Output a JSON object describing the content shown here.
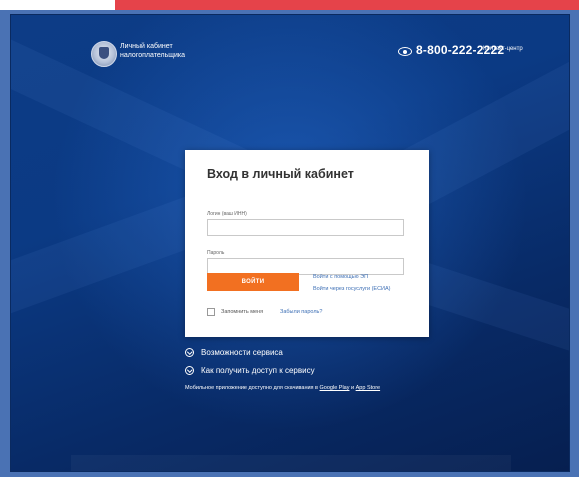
{
  "header": {
    "brand_line1": "Личный кабинет",
    "brand_line2": "налогоплательщика",
    "phone": "8-800-222-2222",
    "contact_center": "Контакт-центр"
  },
  "login": {
    "title": "Вход в личный кабинет",
    "login_label": "Логин (ваш ИНН)",
    "login_value": "",
    "password_label": "Пароль",
    "password_value": "",
    "submit_label": "ВОЙТИ",
    "ep_link": "Войти с помощью ЭП",
    "esia_link": "Войти через госуслуги (ЕСИА)",
    "remember_label": "Запомнить меня",
    "forgot_link": "Забыли пароль?"
  },
  "sections": {
    "features": "Возможности сервиса",
    "how_to_access": "Как получить доступ к сервису"
  },
  "mobile": {
    "text": "Мобильное приложение доступно для скачивания в ",
    "google_play": "Google Play",
    "and": " и ",
    "app_store": "App Store"
  },
  "icons": {
    "eye": "eye-icon",
    "logo": "fns-emblem",
    "expander": "chevron-down-circle-icon"
  },
  "colors": {
    "top_bar": "#e5434a",
    "background": "#0b3a84",
    "button": "#f27021",
    "link": "#3d6fb5"
  }
}
